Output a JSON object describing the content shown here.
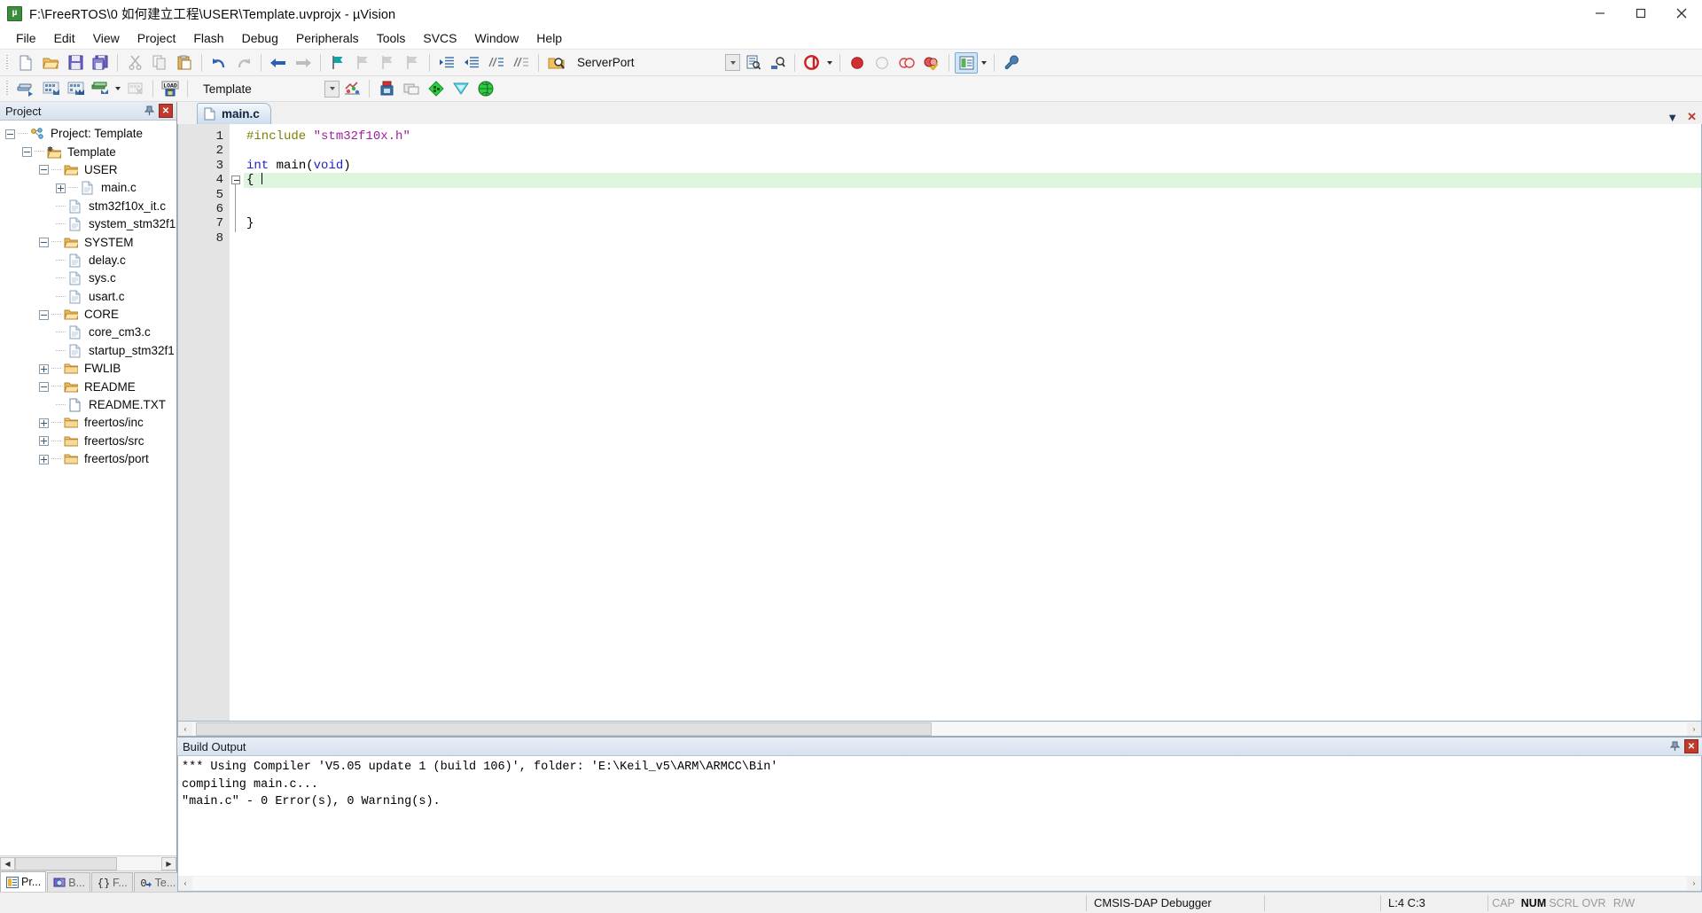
{
  "window": {
    "title": "F:\\FreeRTOS\\0 如何建立工程\\USER\\Template.uvprojx - µVision",
    "app_icon": "uvision-icon",
    "minimize_label": "Minimize",
    "maximize_label": "Maximize",
    "close_label": "Close"
  },
  "menu": {
    "items": [
      {
        "label": "File"
      },
      {
        "label": "Edit"
      },
      {
        "label": "View"
      },
      {
        "label": "Project"
      },
      {
        "label": "Flash"
      },
      {
        "label": "Debug"
      },
      {
        "label": "Peripherals"
      },
      {
        "label": "Tools"
      },
      {
        "label": "SVCS"
      },
      {
        "label": "Window"
      },
      {
        "label": "Help"
      }
    ]
  },
  "toolbar_file": {
    "buttons": [
      {
        "name": "new-file-icon",
        "tooltip": "New"
      },
      {
        "name": "open-file-icon",
        "tooltip": "Open"
      },
      {
        "name": "save-icon",
        "tooltip": "Save"
      },
      {
        "name": "save-all-icon",
        "tooltip": "Save All"
      },
      {
        "name": "cut-icon",
        "tooltip": "Cut"
      },
      {
        "name": "copy-icon",
        "tooltip": "Copy"
      },
      {
        "name": "paste-icon",
        "tooltip": "Paste"
      },
      {
        "name": "undo-icon",
        "tooltip": "Undo"
      },
      {
        "name": "redo-icon",
        "tooltip": "Redo"
      },
      {
        "name": "navigate-back-icon",
        "tooltip": "Back"
      },
      {
        "name": "navigate-forward-icon",
        "tooltip": "Forward"
      },
      {
        "name": "bookmark-toggle-icon",
        "tooltip": "Insert/Remove Bookmark"
      },
      {
        "name": "bookmark-prev-icon",
        "tooltip": "Previous Bookmark"
      },
      {
        "name": "bookmark-next-icon",
        "tooltip": "Next Bookmark"
      },
      {
        "name": "bookmark-clear-icon",
        "tooltip": "Clear All Bookmarks"
      },
      {
        "name": "indent-right-icon",
        "tooltip": "Indent Selected Text"
      },
      {
        "name": "indent-left-icon",
        "tooltip": "Unindent Selected Text"
      },
      {
        "name": "comment-icon",
        "tooltip": "Comment Selection"
      },
      {
        "name": "uncomment-icon",
        "tooltip": "Uncomment Selection"
      },
      {
        "name": "find-in-files-icon",
        "tooltip": "Find in Files"
      }
    ],
    "serverport_value": "ServerPort",
    "after_combo_buttons": [
      {
        "name": "configure-target-icon",
        "tooltip": "Configure Target"
      },
      {
        "name": "debug-settings-icon",
        "tooltip": "Debug Settings"
      }
    ],
    "debug_buttons": [
      {
        "name": "start-debug-icon",
        "tooltip": "Start/Stop Debug Session"
      },
      {
        "name": "breakpoint-insert-icon",
        "tooltip": "Insert/Remove Breakpoint"
      },
      {
        "name": "breakpoint-enable-icon",
        "tooltip": "Enable/Disable Breakpoint"
      },
      {
        "name": "breakpoint-disable-all-icon",
        "tooltip": "Disable All Breakpoints"
      },
      {
        "name": "breakpoint-kill-all-icon",
        "tooltip": "Kill All Breakpoints"
      },
      {
        "name": "window-manager-icon",
        "tooltip": "Manage Window Layout"
      },
      {
        "name": "configure-icon",
        "tooltip": "Configuration Wizard"
      }
    ]
  },
  "toolbar_build": {
    "buttons": [
      {
        "name": "translate-icon",
        "tooltip": "Translate Current File"
      },
      {
        "name": "build-icon",
        "tooltip": "Build Target"
      },
      {
        "name": "rebuild-icon",
        "tooltip": "Rebuild All Target Files"
      },
      {
        "name": "batch-build-icon",
        "tooltip": "Batch Build"
      },
      {
        "name": "stop-build-icon",
        "tooltip": "Stop Build"
      },
      {
        "name": "download-icon",
        "tooltip": "Download"
      }
    ],
    "target_value": "Template",
    "right_buttons": [
      {
        "name": "target-options-icon",
        "tooltip": "Options for Target"
      },
      {
        "name": "manage-project-items-icon",
        "tooltip": "Manage Project Items"
      },
      {
        "name": "packs-install-icon",
        "tooltip": "Pack Installer"
      },
      {
        "name": "manage-runtime-icon",
        "tooltip": "Manage Run-Time Environment"
      },
      {
        "name": "multi-project-icon",
        "tooltip": "Manage Multi-Project Workspace"
      },
      {
        "name": "select-software-packs-icon",
        "tooltip": "Select Software Packs"
      }
    ]
  },
  "project_pane": {
    "title": "Project",
    "pin_icon": "pin-icon",
    "close_icon": "close-icon",
    "tree": [
      {
        "label": "Project: Template",
        "depth": 0,
        "toggle": "minus",
        "icon": "project-icon"
      },
      {
        "label": "Template",
        "depth": 1,
        "toggle": "minus",
        "icon": "target-icon"
      },
      {
        "label": "USER",
        "depth": 2,
        "toggle": "minus",
        "icon": "folder-open-icon"
      },
      {
        "label": "main.c",
        "depth": 3,
        "toggle": "plus",
        "icon": "file-c-icon"
      },
      {
        "label": "stm32f10x_it.c",
        "depth": 3,
        "toggle": "none",
        "icon": "file-c-icon"
      },
      {
        "label": "system_stm32f1",
        "depth": 3,
        "toggle": "none",
        "icon": "file-c-icon"
      },
      {
        "label": "SYSTEM",
        "depth": 2,
        "toggle": "minus",
        "icon": "folder-open-icon"
      },
      {
        "label": "delay.c",
        "depth": 3,
        "toggle": "none",
        "icon": "file-c-icon"
      },
      {
        "label": "sys.c",
        "depth": 3,
        "toggle": "none",
        "icon": "file-c-icon"
      },
      {
        "label": "usart.c",
        "depth": 3,
        "toggle": "none",
        "icon": "file-c-icon"
      },
      {
        "label": "CORE",
        "depth": 2,
        "toggle": "minus",
        "icon": "folder-open-icon"
      },
      {
        "label": "core_cm3.c",
        "depth": 3,
        "toggle": "none",
        "icon": "file-c-icon"
      },
      {
        "label": "startup_stm32f1",
        "depth": 3,
        "toggle": "none",
        "icon": "file-c-icon"
      },
      {
        "label": "FWLIB",
        "depth": 2,
        "toggle": "plus",
        "icon": "folder-closed-icon"
      },
      {
        "label": "README",
        "depth": 2,
        "toggle": "minus",
        "icon": "folder-open-icon"
      },
      {
        "label": "README.TXT",
        "depth": 3,
        "toggle": "none",
        "icon": "file-txt-icon"
      },
      {
        "label": "freertos/inc",
        "depth": 2,
        "toggle": "plus",
        "icon": "folder-closed-icon"
      },
      {
        "label": "freertos/src",
        "depth": 2,
        "toggle": "plus",
        "icon": "folder-closed-icon"
      },
      {
        "label": "freertos/port",
        "depth": 2,
        "toggle": "plus",
        "icon": "folder-closed-icon"
      }
    ],
    "tabs": [
      {
        "label": "Pr...",
        "icon": "project-tab-icon",
        "selected": true
      },
      {
        "label": "B...",
        "icon": "books-tab-icon",
        "selected": false
      },
      {
        "label": "F...",
        "icon": "functions-tab-icon",
        "selected": false
      },
      {
        "label": "Te...",
        "icon": "templates-tab-icon",
        "selected": false
      }
    ],
    "scroll_left_arrow": "◀",
    "scroll_right_arrow": "▶"
  },
  "editor": {
    "tabs": [
      {
        "label": "main.c",
        "icon": "file-c-icon",
        "active": true
      }
    ],
    "tab_caret": "▼",
    "tab_close": "✕",
    "cursor_line": 4,
    "lines": [
      {
        "n": 1,
        "tokens": [
          {
            "t": "#include ",
            "c": "pre"
          },
          {
            "t": "\"stm32f10x.h\"",
            "c": "str"
          }
        ]
      },
      {
        "n": 2,
        "tokens": []
      },
      {
        "n": 3,
        "tokens": [
          {
            "t": "int",
            "c": "key"
          },
          {
            "t": " main(",
            "c": "plain"
          },
          {
            "t": "void",
            "c": "key"
          },
          {
            "t": ")",
            "c": "plain"
          }
        ]
      },
      {
        "n": 4,
        "tokens": [
          {
            "t": "{",
            "c": "plain"
          }
        ]
      },
      {
        "n": 5,
        "tokens": []
      },
      {
        "n": 6,
        "tokens": []
      },
      {
        "n": 7,
        "tokens": [
          {
            "t": "}",
            "c": "plain"
          }
        ]
      },
      {
        "n": 8,
        "tokens": []
      }
    ],
    "scroll_left_arrow": "‹",
    "scroll_right_arrow": "›"
  },
  "build_output": {
    "title": "Build Output",
    "pin_icon": "pin-icon",
    "close_icon": "close-icon",
    "lines": [
      "*** Using Compiler 'V5.05 update 1 (build 106)', folder: 'E:\\Keil_v5\\ARM\\ARMCC\\Bin'",
      "compiling main.c...",
      "\"main.c\" - 0 Error(s), 0 Warning(s)."
    ],
    "scroll_left_arrow": "‹",
    "scroll_right_arrow": "›"
  },
  "statusbar": {
    "debugger": "CMSIS-DAP Debugger",
    "position": "L:4 C:3",
    "flags": [
      {
        "label": "CAP",
        "active": false
      },
      {
        "label": "NUM",
        "active": true
      },
      {
        "label": "SCRL",
        "active": false
      },
      {
        "label": "OVR",
        "active": false
      },
      {
        "label": "R/W",
        "active": false
      }
    ]
  },
  "colors": {
    "accent": "#cfe6f8",
    "pane_header": "#d7e2ee",
    "highlight_line": "#ddf5dd",
    "preprocessor": "#7f7f00",
    "string": "#a020a0",
    "keyword": "#2121c8",
    "close_red": "#c0392b"
  }
}
